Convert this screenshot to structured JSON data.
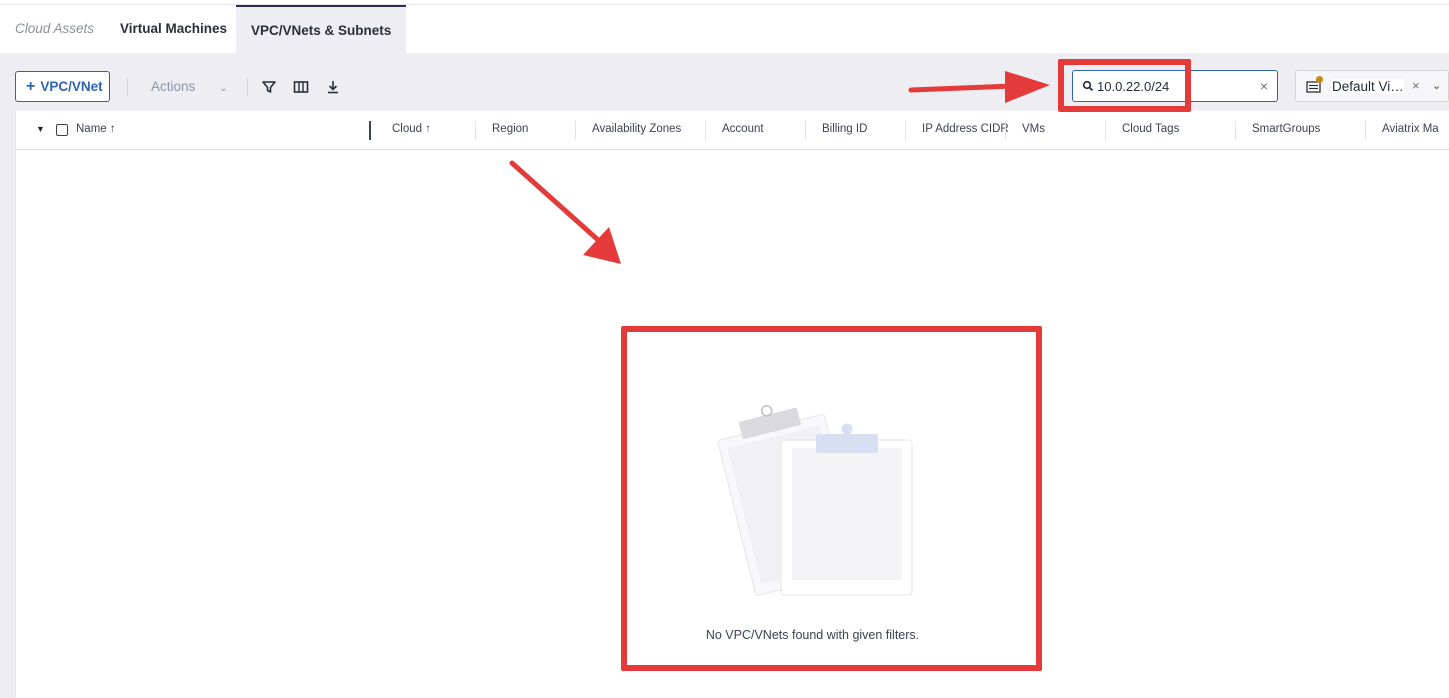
{
  "tabs": {
    "breadcrumb": "Cloud Assets",
    "items": [
      {
        "label": "Virtual Machines"
      },
      {
        "label": "VPC/VNets & Subnets"
      }
    ]
  },
  "toolbar": {
    "add_label": "VPC/VNet",
    "actions_label": "Actions",
    "icons": [
      "filter-icon",
      "columns-icon",
      "download-icon"
    ]
  },
  "search": {
    "value": "10.0.22.0/24",
    "clear": "×"
  },
  "view": {
    "label": "Default Vi…",
    "clear": "×"
  },
  "columns": [
    {
      "label": "Name",
      "sort": "↑"
    },
    {
      "label": "Cloud",
      "sort": "↑"
    },
    {
      "label": "Region"
    },
    {
      "label": "Availability Zones"
    },
    {
      "label": "Account"
    },
    {
      "label": "Billing ID"
    },
    {
      "label": "IP Address CIDR"
    },
    {
      "label": "VMs"
    },
    {
      "label": "Cloud Tags"
    },
    {
      "label": "SmartGroups"
    },
    {
      "label": "Aviatrix Ma"
    }
  ],
  "empty_state": {
    "message": "No VPC/VNets found with given filters."
  },
  "colors": {
    "accent": "#2e64b1",
    "annotation": "#e43a3a",
    "active_tab_border": "#2a2a52"
  }
}
